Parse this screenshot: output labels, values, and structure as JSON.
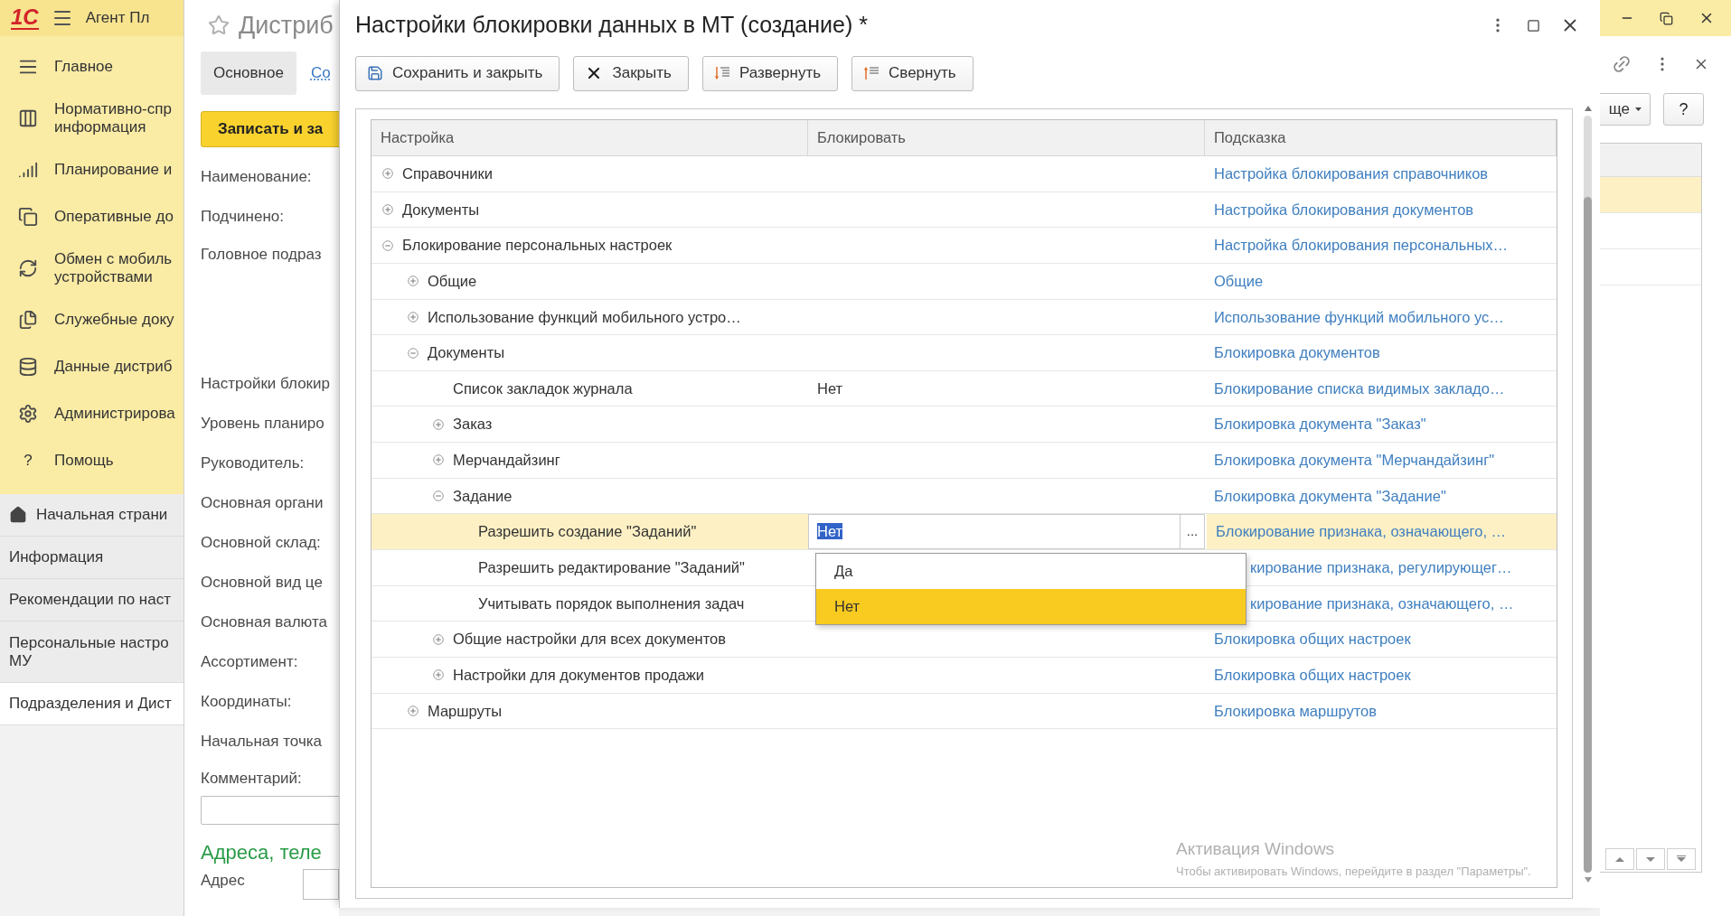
{
  "app": {
    "logo": "1С",
    "title": "Агент Пл"
  },
  "sidebar": {
    "nav": [
      {
        "label": "Главное"
      },
      {
        "label": "Нормативно-спр\nинформация"
      },
      {
        "label": "Планирование и"
      },
      {
        "label": "Оперативные до"
      },
      {
        "label": "Обмен с мобиль\nустройствами"
      },
      {
        "label": "Служебные доку"
      },
      {
        "label": "Данные дистриб"
      },
      {
        "label": "Администрирова"
      },
      {
        "label": "Помощь",
        "glyph": "?"
      }
    ],
    "open_windows": [
      {
        "label": "Начальная страни",
        "selected": false
      },
      {
        "label": "Информация",
        "selected": false
      },
      {
        "label": "Рекомендации по наст",
        "selected": false
      },
      {
        "label": "Персональные настро\nМУ",
        "selected": false
      },
      {
        "label": "Подразделения и Дист",
        "selected": true
      }
    ]
  },
  "background_form": {
    "title": "Дистриб",
    "tabs": [
      {
        "label": "Основное",
        "selected": true
      },
      {
        "label": "Со",
        "selected": false
      }
    ],
    "primary_button": "Записать и за",
    "fields": [
      {
        "label": "Наименование:",
        "kind": "line"
      },
      {
        "label": "Подчинено:",
        "kind": "line"
      },
      {
        "label": "Головное подраз",
        "kind": "tall"
      },
      {
        "label": "Настройки блокир",
        "kind": "line"
      },
      {
        "label": "Уровень планиро",
        "kind": "line"
      },
      {
        "label": "Руководитель:",
        "kind": "line"
      },
      {
        "label": "Основная органи",
        "kind": "line"
      },
      {
        "label": "Основной склад:",
        "kind": "line"
      },
      {
        "label": "Основной вид це",
        "kind": "line"
      },
      {
        "label": "Основная валюта",
        "kind": "line"
      },
      {
        "label": "Ассортимент:",
        "kind": "line"
      },
      {
        "label": "Координаты:",
        "kind": "line"
      },
      {
        "label": "Начальная точка",
        "kind": "line"
      }
    ],
    "comment_label": "Комментарий:",
    "section_heading": "Адреса, теле",
    "address_label": "Адрес"
  },
  "dialog": {
    "title": "Настройки блокировки данных в МТ (создание) *",
    "toolbar": [
      {
        "label": "Сохранить и закрыть"
      },
      {
        "label": "Закрыть"
      },
      {
        "label": "Развернуть"
      },
      {
        "label": "Свернуть"
      }
    ],
    "table": {
      "columns": [
        "Настройка",
        "Блокировать",
        "Подсказка"
      ],
      "rows": [
        {
          "label": "Справочники",
          "expanded": false,
          "hint": "Настройка блокирования справочников",
          "selected": false
        },
        {
          "label": "Документы",
          "expanded": false,
          "hint": "Настройка блокирования документов",
          "selected": false
        },
        {
          "label": "Блокирование персональных настроек",
          "expanded": true,
          "hint": "Настройка блокирования персональных…",
          "selected": false,
          "children": [
            {
              "label": "Общие",
              "expanded": false,
              "hint": "Общие",
              "selected": false
            },
            {
              "label": "Использование функций мобильного устро…",
              "expanded": false,
              "hint": "Использование функций мобильного ус…",
              "selected": false
            },
            {
              "label": "Документы",
              "expanded": true,
              "hint": "Блокировка документов",
              "selected": false,
              "children": [
                {
                  "label": "Список закладок журнала",
                  "value": "Нет",
                  "hint": "Блокирование списка видимых закладо…",
                  "selected": false
                },
                {
                  "label": "Заказ",
                  "expanded": false,
                  "hint": "Блокировка документа \"Заказ\"",
                  "selected": false
                },
                {
                  "label": "Мерчандайзинг",
                  "expanded": false,
                  "hint": "Блокировка документа \"Мерчандайзинг\"",
                  "selected": false
                },
                {
                  "label": "Задание",
                  "expanded": true,
                  "hint": "Блокировка документа \"Задание\"",
                  "selected": false,
                  "children": [
                    {
                      "label": "Разрешить создание \"Заданий\"",
                      "value": "Нет",
                      "hint": "Блокирование признака, означающего, …",
                      "selected": true
                    },
                    {
                      "label": "Разрешить редактирование \"Заданий\"",
                      "hint": "кирование признака, регулирующег…",
                      "selected": false
                    },
                    {
                      "label": "Учитывать порядок выполнения задач",
                      "hint": "кирование признака, означающего, …",
                      "selected": false
                    }
                  ]
                },
                {
                  "label": "Общие настройки для всех документов",
                  "expanded": false,
                  "hint": "Блокировка общих настроек",
                  "selected": false
                },
                {
                  "label": "Настройки для документов продажи",
                  "expanded": false,
                  "hint": "Блокировка общих настроек",
                  "selected": false
                }
              ]
            },
            {
              "label": "Маршруты",
              "expanded": false,
              "hint": "Блокировка маршрутов",
              "selected": false
            }
          ]
        }
      ],
      "picker_button": "...",
      "dropdown": {
        "options": [
          {
            "label": "Да",
            "selected": false
          },
          {
            "label": "Нет",
            "selected": true
          }
        ]
      }
    }
  },
  "right_panel": {
    "more_button": "ще",
    "help_button": "?",
    "list_rows": [
      {
        "selected": true
      },
      {
        "selected": false
      },
      {
        "selected": false
      }
    ]
  },
  "os_notice": {
    "title": "Активация Windows",
    "text": "Чтобы активировать Windows, перейдите в раздел \"Параметры\"."
  }
}
